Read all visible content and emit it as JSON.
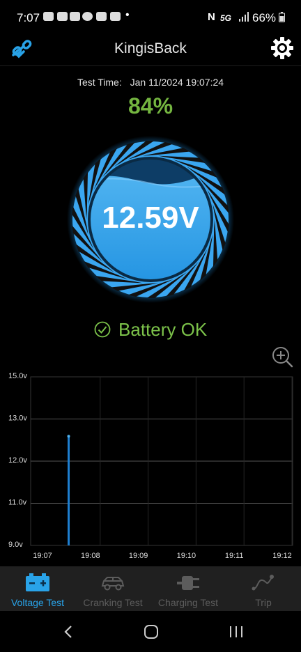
{
  "status_bar": {
    "time": "7:07",
    "battery": "66%",
    "network": "5G"
  },
  "header": {
    "title": "KingisBack"
  },
  "test": {
    "time_label": "Test Time:",
    "time_value": "Jan 11/2024 19:07:24",
    "percent": "84%",
    "voltage": "12.59V",
    "status": "Battery OK"
  },
  "colors": {
    "accent_blue": "#29a3e8",
    "ok_green": "#74b540"
  },
  "chart_data": {
    "type": "line",
    "y_tick_labels": [
      "15.0v",
      "13.0v",
      "12.0v",
      "11.0v",
      "9.0v"
    ],
    "x_tick_labels": [
      "19:07",
      "19:08",
      "19:09",
      "19:10",
      "19:11",
      "19:12"
    ],
    "series": [
      {
        "x": [
          "19:07:24"
        ],
        "y": [
          12.59
        ]
      }
    ],
    "grid": true
  },
  "bottom_nav": {
    "items": [
      {
        "label": "Voltage Test",
        "icon": "battery-icon",
        "active": true
      },
      {
        "label": "Cranking Test",
        "icon": "car-icon",
        "active": false
      },
      {
        "label": "Charging Test",
        "icon": "plug-icon",
        "active": false
      },
      {
        "label": "Trip",
        "icon": "route-icon",
        "active": false
      }
    ]
  }
}
